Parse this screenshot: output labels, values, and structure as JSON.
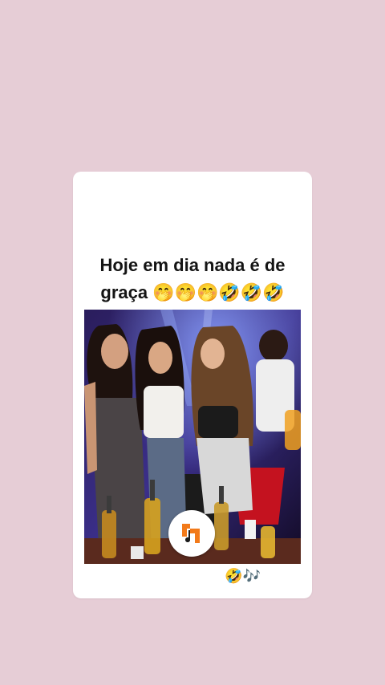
{
  "post": {
    "caption_line1": "Hoje em dia nada é de",
    "caption_line2_text": "graça",
    "caption_line2_emojis": "🤭🤭🤭🤣🤣🤣",
    "reaction": "🤣🎶"
  },
  "video": {
    "scene": "party-video-frame",
    "logo_icon": "music-app-logo-icon"
  },
  "colors": {
    "background": "#e6cdd6",
    "card": "#ffffff",
    "caption_text": "#141414",
    "logo_orange": "#f27a1a"
  }
}
